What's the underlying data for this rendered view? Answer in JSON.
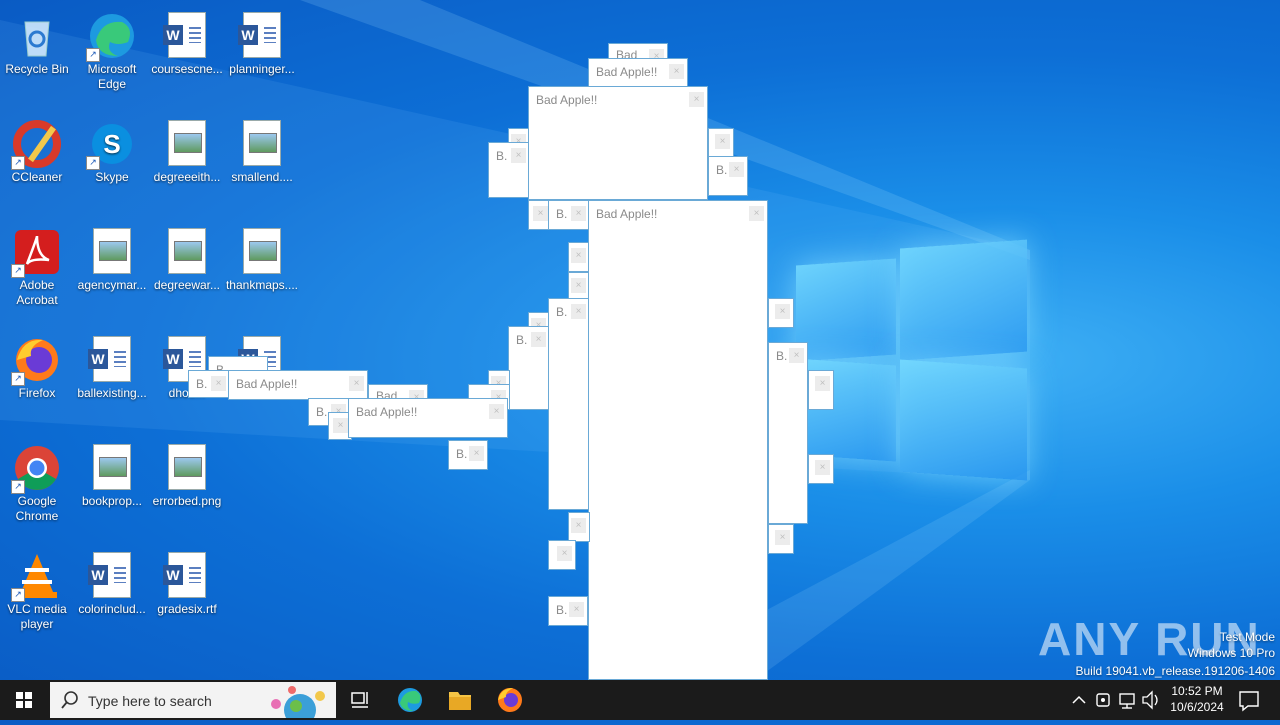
{
  "desktop_icons": [
    {
      "label": "Recycle Bin",
      "icon": "recycle-bin-icon"
    },
    {
      "label": "Microsoft Edge",
      "icon": "edge-icon"
    },
    {
      "label": "coursescne...",
      "icon": "word-doc-icon"
    },
    {
      "label": "planninger...",
      "icon": "word-doc-icon"
    },
    {
      "label": "CCleaner",
      "icon": "ccleaner-icon"
    },
    {
      "label": "Skype",
      "icon": "skype-icon"
    },
    {
      "label": "degreeeith...",
      "icon": "image-file-icon"
    },
    {
      "label": "smallend....",
      "icon": "image-file-icon"
    },
    {
      "label": "Adobe Acrobat",
      "icon": "acrobat-icon"
    },
    {
      "label": "agencymar...",
      "icon": "image-file-icon"
    },
    {
      "label": "degreewar...",
      "icon": "image-file-icon"
    },
    {
      "label": "thankmaps....",
      "icon": "image-file-icon"
    },
    {
      "label": "Firefox",
      "icon": "firefox-icon"
    },
    {
      "label": "ballexisting...",
      "icon": "word-doc-icon"
    },
    {
      "label": "dhou...",
      "icon": "word-doc-icon"
    },
    {
      "label": "",
      "icon": "word-doc-icon"
    },
    {
      "label": "Google Chrome",
      "icon": "chrome-icon"
    },
    {
      "label": "bookprop...",
      "icon": "image-file-icon"
    },
    {
      "label": "errorbed.png",
      "icon": "image-file-icon"
    },
    {
      "label": "VLC media player",
      "icon": "vlc-icon"
    },
    {
      "label": "colorinclud...",
      "icon": "word-doc-icon"
    },
    {
      "label": "gradesix.rtf",
      "icon": "word-doc-icon"
    }
  ],
  "popup_windows": {
    "full_title": "Bad Apple!!",
    "short_title": "B.",
    "partial_title": "Bad",
    "close_glyph": "×"
  },
  "taskbar": {
    "search_placeholder": "Type here to search",
    "time": "10:52 PM",
    "date": "10/6/2024"
  },
  "watermark": {
    "brand": "ANY RUN",
    "line1": "Test Mode",
    "line2": "Windows 10 Pro",
    "line3": "Build 19041.vb_release.191206-1406"
  },
  "colors": {
    "taskbar": "#1b1b1b",
    "desktop": "#0d6fd6",
    "window_border": "#6aa9d6"
  }
}
